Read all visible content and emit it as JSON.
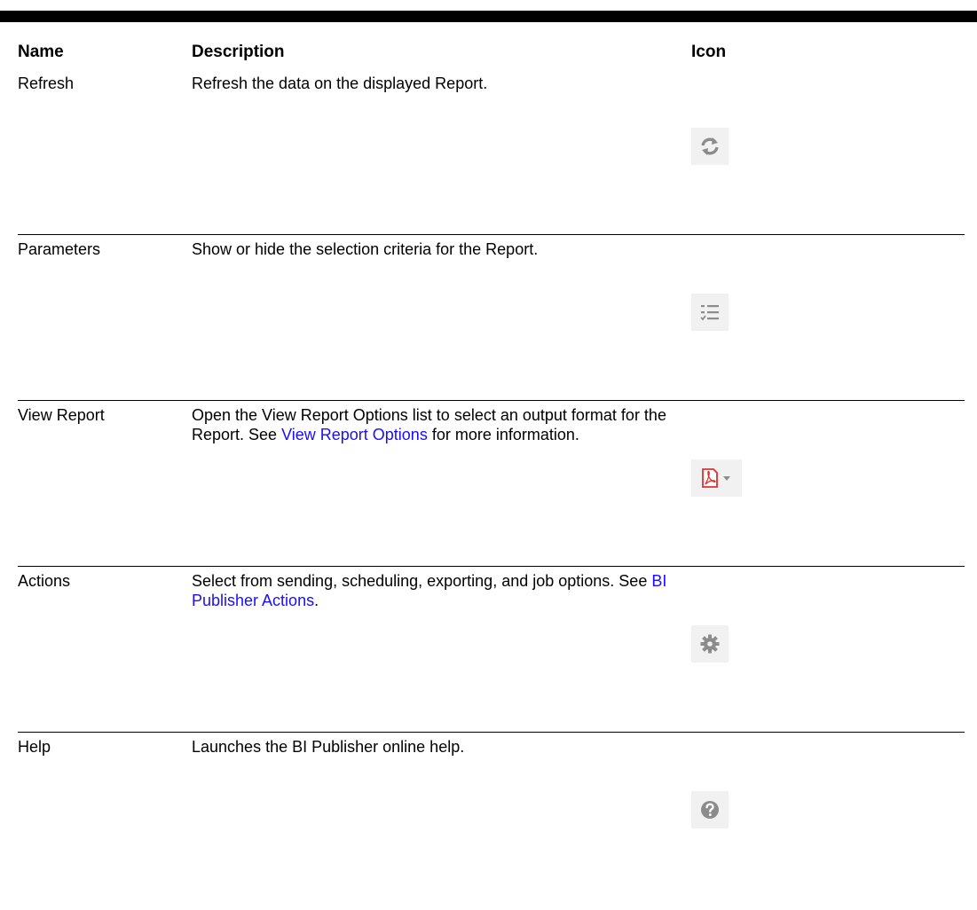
{
  "table": {
    "headers": {
      "name": "Name",
      "description": "Description",
      "icon": "Icon"
    },
    "rows": [
      {
        "name": "Refresh",
        "description": "Refresh the data on the displayed Report.",
        "icon": "refresh-icon"
      },
      {
        "name": "Parameters",
        "description": "Show or hide the selection criteria for the Report.",
        "icon": "parameters-list-icon"
      },
      {
        "name": "View Report",
        "description_before_link": "Open the View Report Options list to select an output format for the Report. See ",
        "link": "View Report Options",
        "description_after_link": " for more information.",
        "icon": "pdf-dropdown-icon"
      },
      {
        "name": "Actions",
        "description_before_link": "Select from sending, scheduling, exporting, and job options. See ",
        "link": "BI Publisher Actions",
        "description_after_link": ".",
        "icon": "gear-icon"
      },
      {
        "name": "Help",
        "description": "Launches the BI Publisher online help.",
        "icon": "help-icon"
      }
    ]
  },
  "colors": {
    "link": "#1a0dff",
    "icon_gray": "#8c8c8c",
    "pdf_red": "#e0302f"
  }
}
